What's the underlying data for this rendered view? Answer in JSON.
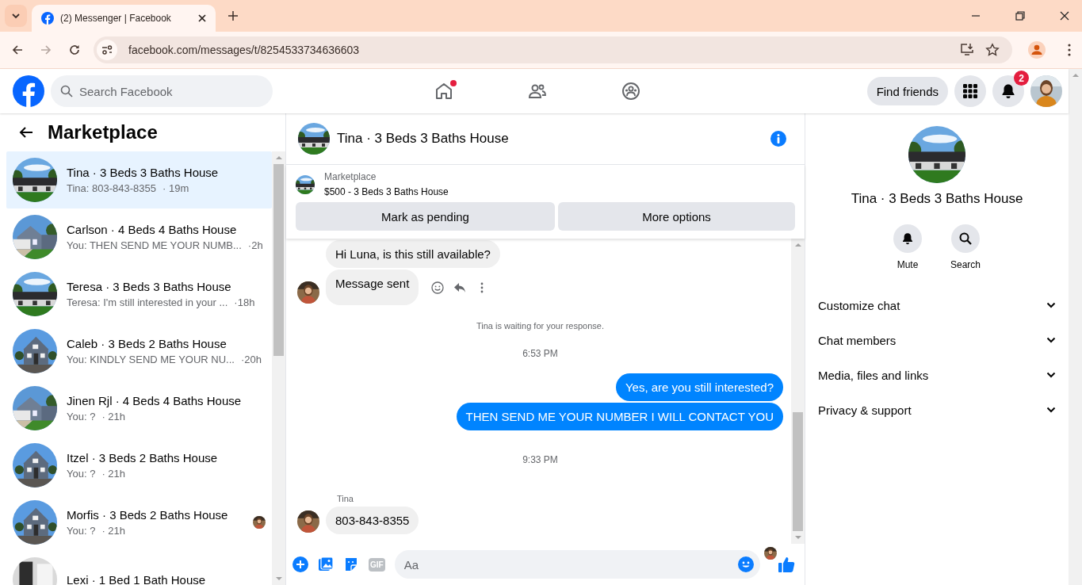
{
  "browser": {
    "tab_title": "(2) Messenger | Facebook",
    "url": "facebook.com/messages/t/8254533734636603"
  },
  "header": {
    "search_placeholder": "Search Facebook",
    "nav": [
      {
        "kind": "home",
        "dot": true
      },
      {
        "kind": "friends",
        "dot": false
      },
      {
        "kind": "groups",
        "dot": false
      }
    ],
    "find_friends": "Find friends",
    "notification_count": "2"
  },
  "sidebar": {
    "title": "Marketplace",
    "conversations": [
      {
        "name": "Tina · 3 Beds 3 Baths House",
        "preview": "Tina: 803-843-8355",
        "time": "· 19m",
        "selected": true,
        "seen": false
      },
      {
        "name": "Carlson · 4 Beds 4 Baths House",
        "preview": "You: THEN SEND ME YOUR NUMB...",
        "time": "·2h",
        "selected": false,
        "seen": false
      },
      {
        "name": "Teresa · 3 Beds 3 Baths House",
        "preview": "Teresa: I'm still interested in your ...",
        "time": "·18h",
        "selected": false,
        "seen": false
      },
      {
        "name": "Caleb · 3 Beds 2 Baths House",
        "preview": "You: KINDLY SEND ME YOUR NU...",
        "time": "·20h",
        "selected": false,
        "seen": false
      },
      {
        "name": "Jinen Rjl · 4 Beds 4 Baths House",
        "preview": "You: ?",
        "time": "· 21h",
        "selected": false,
        "seen": false
      },
      {
        "name": "Itzel · 3 Beds 2 Baths House",
        "preview": "You: ?",
        "time": "· 21h",
        "selected": false,
        "seen": false
      },
      {
        "name": "Morfis · 3 Beds 2 Baths House",
        "preview": "You: ?",
        "time": "· 21h",
        "selected": false,
        "seen": true
      },
      {
        "name": "Lexi · 1 Bed 1 Bath House",
        "selected": false,
        "seen": false
      }
    ]
  },
  "chat": {
    "title": "Tina · 3 Beds 3 Baths House",
    "listing": {
      "label": "Marketplace",
      "title": "$500 - 3 Beds 3 Baths House"
    },
    "buttons": [
      "Mark as pending",
      "More options"
    ],
    "messages": [
      {
        "kind": "incoming",
        "text": "Hi Luna, is this still available?",
        "avatar": false,
        "actions": false
      },
      {
        "kind": "incoming",
        "text": "Message sent",
        "avatar": true,
        "actions": true
      },
      {
        "kind": "notice",
        "text": "Tina is waiting for your response."
      },
      {
        "kind": "time",
        "text": "6:53 PM"
      },
      {
        "kind": "outgoing",
        "text": "Yes, are you still interested?"
      },
      {
        "kind": "outgoing",
        "text": "THEN SEND ME YOUR NUMBER I WILL CONTACT YOU"
      },
      {
        "kind": "time",
        "text": "9:33 PM"
      },
      {
        "kind": "sender",
        "text": "Tina"
      },
      {
        "kind": "incoming",
        "text": "803-843-8355",
        "avatar": true,
        "actions": false
      }
    ],
    "composer": {
      "gif": "GIF",
      "placeholder": "Aa"
    }
  },
  "details": {
    "title": "Tina · 3 Beds 3 Baths House",
    "actions": [
      {
        "kind": "mute",
        "label": "Mute"
      },
      {
        "kind": "search",
        "label": "Search"
      }
    ],
    "sections": [
      {
        "label": "Customize chat",
        "expanded": false
      },
      {
        "label": "Chat members",
        "expanded": false
      },
      {
        "label": "Media, files and links",
        "expanded": false
      },
      {
        "label": "Privacy & support",
        "expanded": false
      }
    ]
  }
}
